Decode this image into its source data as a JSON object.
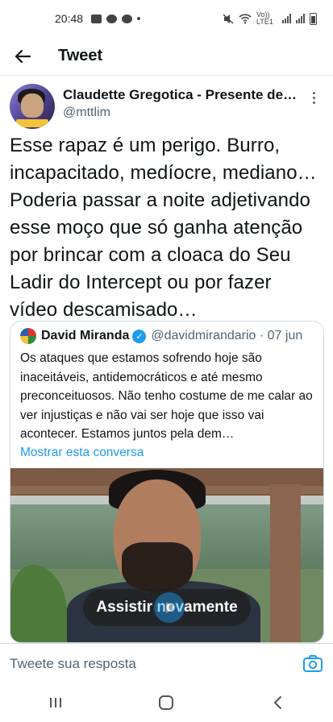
{
  "status_bar": {
    "time": "20:48",
    "network": "Vo)) LTE1"
  },
  "header": {
    "title": "Tweet"
  },
  "tweet": {
    "author_name": "Claudette Gregotica - Presente de…",
    "author_handle": "@mttlim",
    "text": "Esse rapaz é um perigo. Burro, incapacitado, medíocre, mediano… Poderia passar a noite adjetivando esse moço que só ganha atenção por brincar com a cloaca do Seu Ladir do Intercept ou por fazer vídeo descamisado…"
  },
  "quote": {
    "name": "David Miranda",
    "handle_date": "@davidmirandario · 07 jun",
    "text": "Os ataques que estamos sofrendo hoje são inaceitáveis, antidemocráticos e até mesmo preconceituosos. Não tenho costume de me calar ao ver injustiças e não vai ser hoje que isso vai acontecer. Estamos juntos pela dem…",
    "show_thread": "Mostrar esta conversa",
    "replay_label": "Assistir novamente"
  },
  "reply": {
    "placeholder": "Tweete sua resposta"
  },
  "colors": {
    "accent": "#1d9bf0",
    "text": "#0f1419",
    "muted": "#536471"
  }
}
